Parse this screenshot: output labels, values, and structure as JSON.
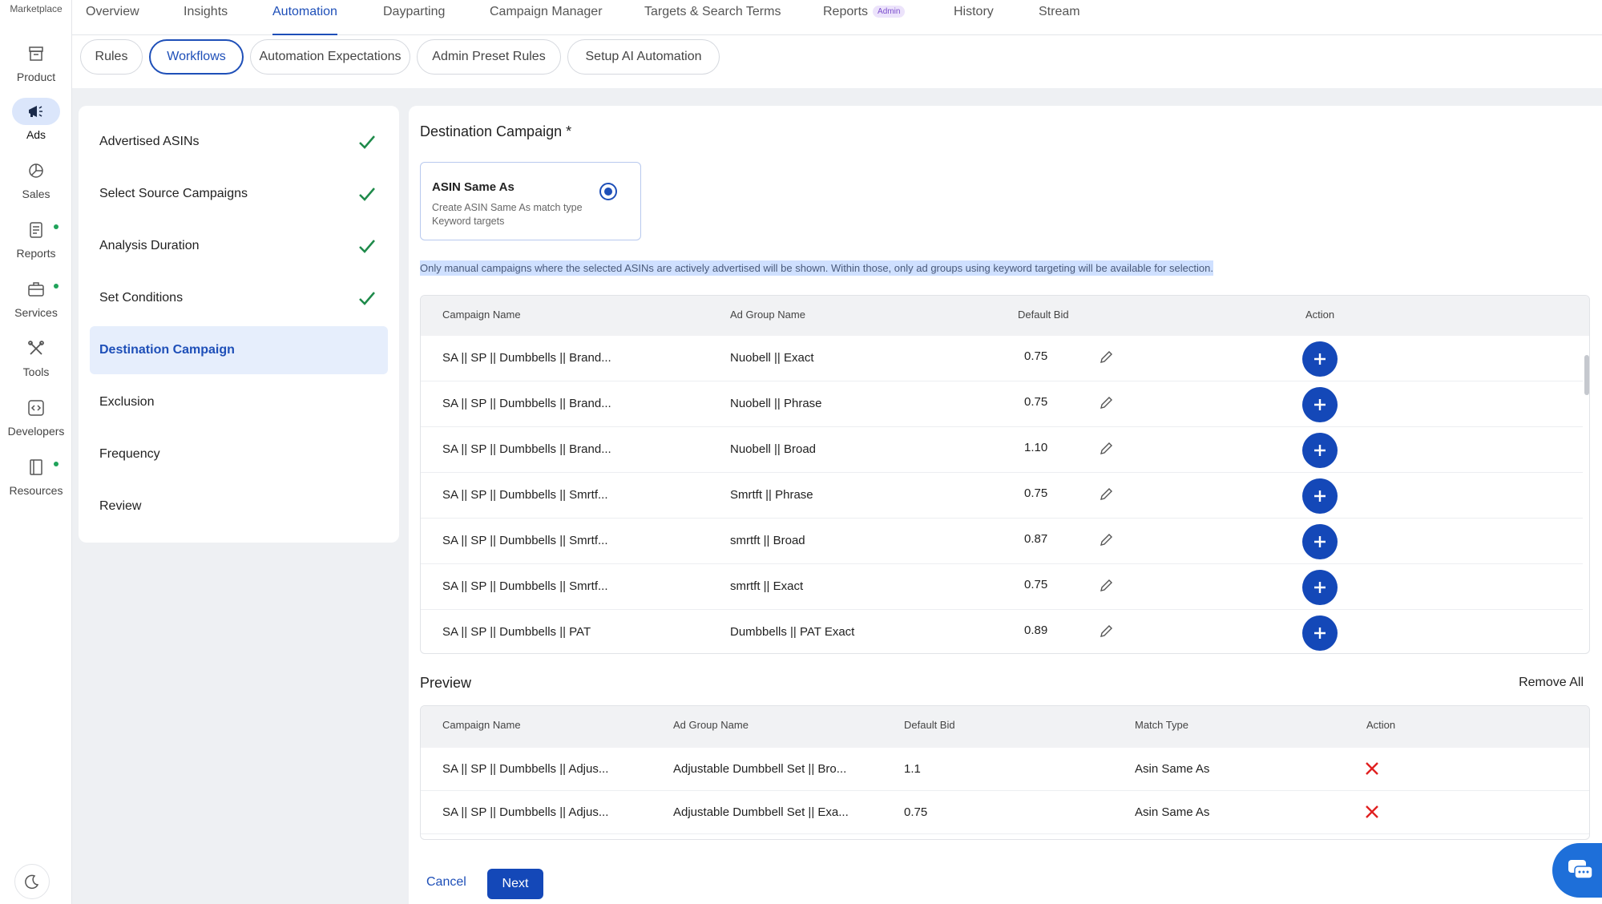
{
  "rail": {
    "marketplace": "Marketplace",
    "items": [
      {
        "label": "Product",
        "icon": "archive-icon",
        "dot": false
      },
      {
        "label": "Ads",
        "icon": "megaphone-icon",
        "dot": false
      },
      {
        "label": "Sales",
        "icon": "pie-chart-icon",
        "dot": false
      },
      {
        "label": "Reports",
        "icon": "report-icon",
        "dot": true
      },
      {
        "label": "Services",
        "icon": "briefcase-icon",
        "dot": true
      },
      {
        "label": "Tools",
        "icon": "tools-icon",
        "dot": false
      },
      {
        "label": "Developers",
        "icon": "code-icon",
        "dot": false
      },
      {
        "label": "Resources",
        "icon": "book-icon",
        "dot": true
      }
    ]
  },
  "topnav": {
    "tabs": [
      "Overview",
      "Insights",
      "Automation",
      "Dayparting",
      "Campaign Manager",
      "Targets & Search Terms",
      "Reports",
      "History",
      "Stream"
    ],
    "admin_badge": "Admin"
  },
  "subtabs": [
    "Rules",
    "Workflows",
    "Automation Expectations",
    "Admin Preset Rules",
    "Setup AI Automation"
  ],
  "steps": [
    "Advertised ASINs",
    "Select Source Campaigns",
    "Analysis Duration",
    "Set Conditions",
    "Destination Campaign",
    "Exclusion",
    "Frequency",
    "Review"
  ],
  "destination": {
    "heading": "Destination Campaign *",
    "card_title": "ASIN Same As",
    "card_desc": "Create ASIN Same As match type Keyword targets",
    "note": "Only manual campaigns where the selected ASINs are actively advertised will be shown. Within those, only ad groups using keyword targeting will be available for selection."
  },
  "table1": {
    "headers": [
      "Campaign Name",
      "Ad Group Name",
      "Default Bid",
      "Action"
    ],
    "rows": [
      [
        "SA || SP || Dumbbells || Brand...",
        "Nuobell || Exact",
        "0.75"
      ],
      [
        "SA || SP || Dumbbells || Brand...",
        "Nuobell || Phrase",
        "0.75"
      ],
      [
        "SA || SP || Dumbbells || Brand...",
        "Nuobell || Broad",
        "1.10"
      ],
      [
        "SA || SP || Dumbbells || Smrtf...",
        "Smrtft || Phrase",
        "0.75"
      ],
      [
        "SA || SP || Dumbbells || Smrtf...",
        "smrtft || Broad",
        "0.87"
      ],
      [
        "SA || SP || Dumbbells || Smrtf...",
        "smrtft || Exact",
        "0.75"
      ],
      [
        "SA || SP || Dumbbells || PAT",
        "Dumbbells || PAT Exact",
        "0.89"
      ]
    ]
  },
  "preview": {
    "heading": "Preview",
    "remove_all": "Remove All",
    "headers": [
      "Campaign Name",
      "Ad Group Name",
      "Default Bid",
      "Match Type",
      "Action"
    ],
    "rows": [
      [
        "SA || SP || Dumbbells || Adjus...",
        "Adjustable Dumbbell Set || Bro...",
        "1.1",
        "Asin Same As"
      ],
      [
        "SA || SP || Dumbbells || Adjus...",
        "Adjustable Dumbbell Set || Exa...",
        "0.75",
        "Asin Same As"
      ]
    ]
  },
  "footer": {
    "cancel": "Cancel",
    "next": "Next"
  },
  "colors": {
    "accent": "#1e4fb8",
    "success": "#1e8a4a",
    "danger": "#e02020"
  }
}
